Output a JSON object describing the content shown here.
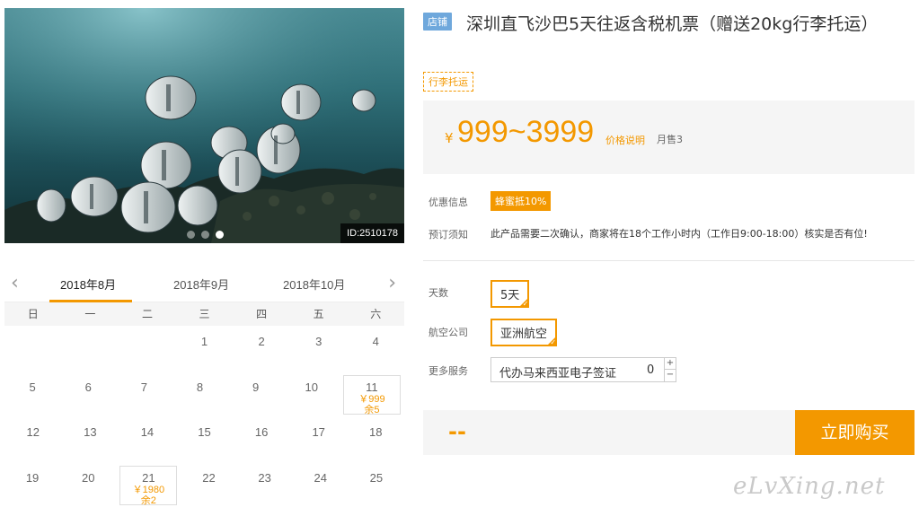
{
  "image": {
    "id_badge": "ID:2510178",
    "carousel_dots": 3,
    "carousel_active": 2
  },
  "calendar": {
    "months": [
      "2018年8月",
      "2018年9月",
      "2018年10月"
    ],
    "active_month": 0,
    "weekdays": [
      "日",
      "一",
      "二",
      "三",
      "四",
      "五",
      "六"
    ],
    "rows": [
      [
        {
          "d": ""
        },
        {
          "d": ""
        },
        {
          "d": ""
        },
        {
          "d": "1"
        },
        {
          "d": "2"
        },
        {
          "d": "3"
        },
        {
          "d": "4"
        }
      ],
      [
        {
          "d": "5"
        },
        {
          "d": "6"
        },
        {
          "d": "7"
        },
        {
          "d": "8"
        },
        {
          "d": "9"
        },
        {
          "d": "10"
        },
        {
          "d": "11",
          "price": "￥999",
          "stock": "余5"
        }
      ],
      [
        {
          "d": "12"
        },
        {
          "d": "13"
        },
        {
          "d": "14"
        },
        {
          "d": "15"
        },
        {
          "d": "16"
        },
        {
          "d": "17"
        },
        {
          "d": "18"
        }
      ],
      [
        {
          "d": "19"
        },
        {
          "d": "20"
        },
        {
          "d": "21",
          "price": "￥1980",
          "stock": "余2"
        },
        {
          "d": "22"
        },
        {
          "d": "23"
        },
        {
          "d": "24"
        },
        {
          "d": "25"
        }
      ]
    ]
  },
  "product": {
    "shop_tag": "店铺",
    "title": "深圳直飞沙巴5天往返含税机票（赠送20kg行李托运）",
    "luggage_tag": "行李托运"
  },
  "price": {
    "currency": "¥",
    "range": "999~3999",
    "note": "价格说明",
    "sold": "月售3"
  },
  "info": {
    "promo_label": "优惠信息",
    "promo_badge": "蜂蜜抵10%",
    "notice_label": "预订须知",
    "notice_text": "此产品需要二次确认，商家将在18个工作小时内（工作日9:00-18:00）核实是否有位!"
  },
  "options": {
    "days_label": "天数",
    "days_value": "5天",
    "airline_label": "航空公司",
    "airline_value": "亚洲航空",
    "service_label": "更多服务",
    "service_name": "代办马来西亚电子签证",
    "service_qty": "0"
  },
  "purchase": {
    "total": "--",
    "buy_label": "立即购买"
  },
  "watermark": "eLvXing.net",
  "colors": {
    "accent": "#f39800",
    "shop_tag": "#6fa8dc"
  }
}
